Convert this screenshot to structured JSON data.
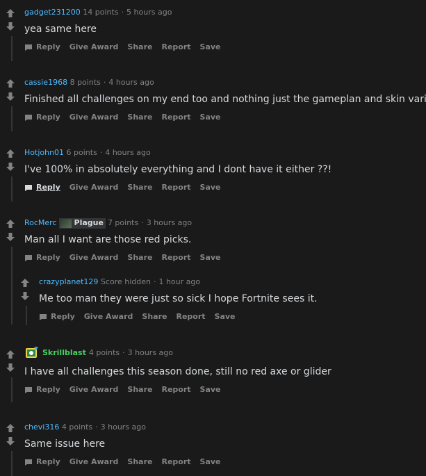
{
  "colors": {
    "background": "#1a1a1b",
    "username": "#4fbcff",
    "meta": "#818384",
    "text": "#d7dadc",
    "thread_line": "#343536"
  },
  "actions": {
    "reply": "Reply",
    "give_award": "Give Award",
    "share": "Share",
    "report": "Report",
    "save": "Save"
  },
  "comments": [
    {
      "author": "gadget231200",
      "points": "14 points",
      "time": "5 hours ago",
      "text": "yea same here"
    },
    {
      "author": "cassie1968",
      "points": "8 points",
      "time": "4 hours ago",
      "text": "Finished all challenges on my end too and nothing just the gameplan and skin variant."
    },
    {
      "author": "Hotjohn01",
      "points": "6 points",
      "time": "4 hours ago",
      "text": "I've 100% in absolutely everything and I dont have it either ??!"
    },
    {
      "author": "RocMerc",
      "flair": "Plague",
      "points": "7 points",
      "time": "3 hours ago",
      "text": "Man all I want are those red picks."
    },
    {
      "author": "crazyplanet129",
      "points": "Score hidden",
      "time": "1 hour ago",
      "text": "Me too man they were just so sick I hope Fortnite sees it."
    },
    {
      "author": "Skrillblast",
      "points": "4 points",
      "time": "3 hours ago",
      "text": "I have all challenges this season done, still no red axe or glider"
    },
    {
      "author": "chevi316",
      "points": "4 points",
      "time": "3 hours ago",
      "text": "Same issue here"
    }
  ]
}
